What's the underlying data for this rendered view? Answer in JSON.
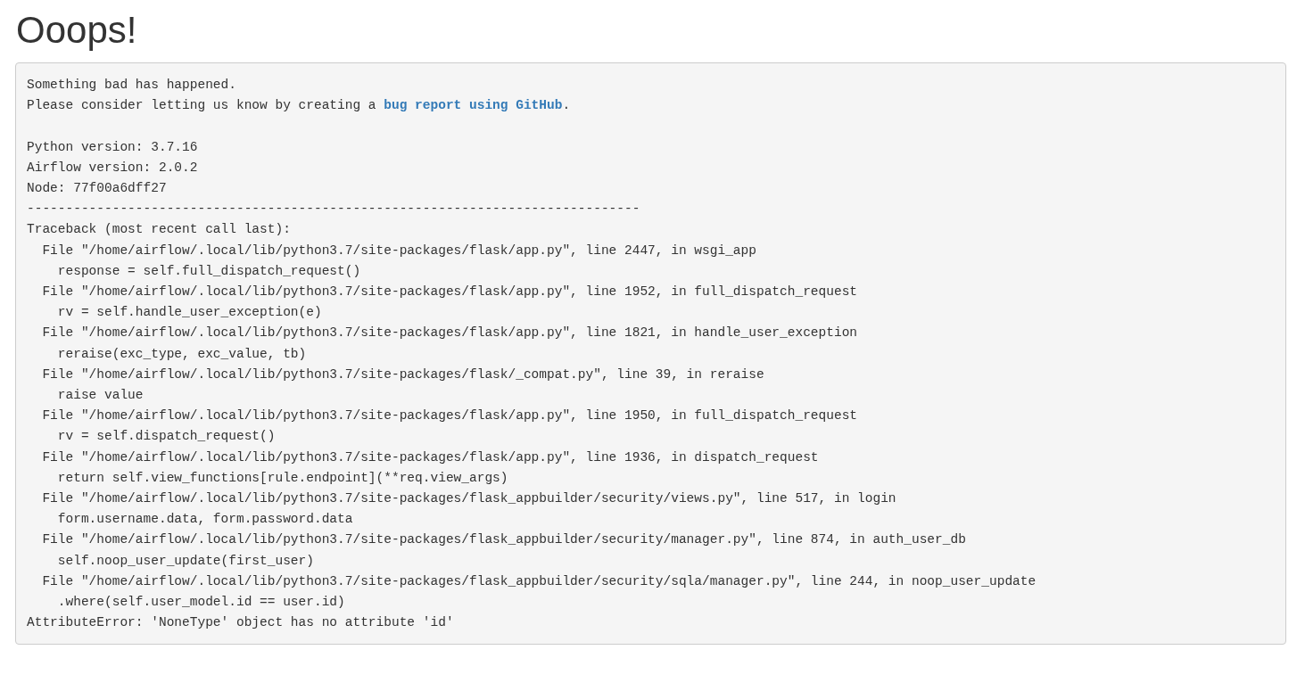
{
  "title": "Ooops!",
  "message": {
    "intro": "Something bad has happened.",
    "before_link": "Please consider letting us know by creating a ",
    "link": "bug report using GitHub",
    "after_link": "."
  },
  "info": [
    "Python version: 3.7.16",
    "Airflow version: 2.0.2",
    "Node: 77f00a6dff27"
  ],
  "separator": "-------------------------------------------------------------------------------",
  "traceback": [
    "Traceback (most recent call last):",
    "  File \"/home/airflow/.local/lib/python3.7/site-packages/flask/app.py\", line 2447, in wsgi_app",
    "    response = self.full_dispatch_request()",
    "  File \"/home/airflow/.local/lib/python3.7/site-packages/flask/app.py\", line 1952, in full_dispatch_request",
    "    rv = self.handle_user_exception(e)",
    "  File \"/home/airflow/.local/lib/python3.7/site-packages/flask/app.py\", line 1821, in handle_user_exception",
    "    reraise(exc_type, exc_value, tb)",
    "  File \"/home/airflow/.local/lib/python3.7/site-packages/flask/_compat.py\", line 39, in reraise",
    "    raise value",
    "  File \"/home/airflow/.local/lib/python3.7/site-packages/flask/app.py\", line 1950, in full_dispatch_request",
    "    rv = self.dispatch_request()",
    "  File \"/home/airflow/.local/lib/python3.7/site-packages/flask/app.py\", line 1936, in dispatch_request",
    "    return self.view_functions[rule.endpoint](**req.view_args)",
    "  File \"/home/airflow/.local/lib/python3.7/site-packages/flask_appbuilder/security/views.py\", line 517, in login",
    "    form.username.data, form.password.data",
    "  File \"/home/airflow/.local/lib/python3.7/site-packages/flask_appbuilder/security/manager.py\", line 874, in auth_user_db",
    "    self.noop_user_update(first_user)",
    "  File \"/home/airflow/.local/lib/python3.7/site-packages/flask_appbuilder/security/sqla/manager.py\", line 244, in noop_user_update",
    "    .where(self.user_model.id == user.id)",
    "AttributeError: 'NoneType' object has no attribute 'id'"
  ]
}
